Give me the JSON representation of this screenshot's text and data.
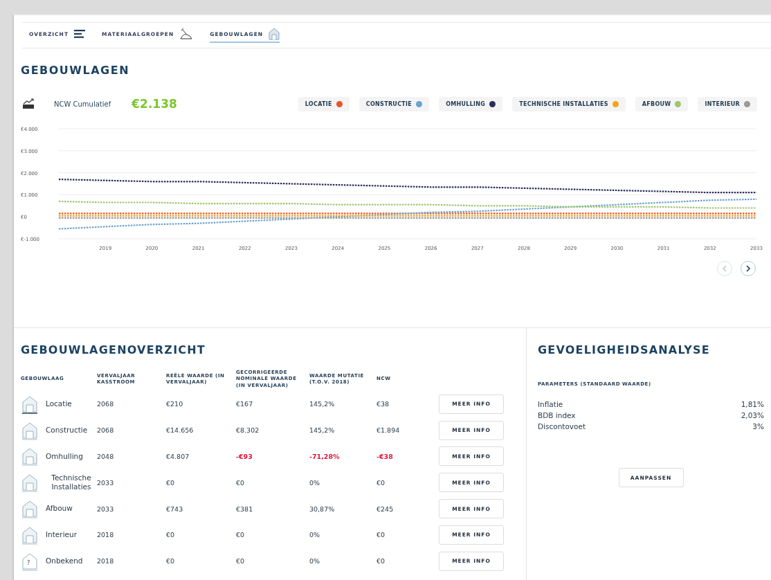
{
  "nav": [
    {
      "label": "OVERZICHT",
      "selected": false
    },
    {
      "label": "MATERIAALGROEPEN",
      "selected": false
    },
    {
      "label": "GEBOUWLAGEN",
      "selected": true
    }
  ],
  "title": "GEBOUWLAGEN",
  "summary": {
    "label": "NCW Cumulatief",
    "value": "€2.138"
  },
  "chart_data": {
    "type": "line",
    "grid": true,
    "xlim": [
      2018,
      2033
    ],
    "x": [
      2018,
      2019,
      2020,
      2021,
      2022,
      2023,
      2024,
      2025,
      2026,
      2027,
      2028,
      2029,
      2030,
      2031,
      2032,
      2033
    ],
    "xticks": [
      2019,
      2020,
      2021,
      2022,
      2023,
      2024,
      2025,
      2026,
      2027,
      2028,
      2029,
      2030,
      2031,
      2032,
      2033
    ],
    "yticks": [
      {
        "value": -1000,
        "label": "€-1.000"
      },
      {
        "value": 0,
        "label": "€0"
      },
      {
        "value": 1000,
        "label": "€1.000"
      },
      {
        "value": 2000,
        "label": "€2.000"
      },
      {
        "value": 3000,
        "label": "€3.000"
      },
      {
        "value": 4000,
        "label": "€4.000"
      }
    ],
    "ylim": [
      -1000,
      4000
    ],
    "series": [
      {
        "name": "LOCATIE",
        "color": "#e9542d",
        "line_style": "dotted",
        "values": [
          150,
          150,
          150,
          150,
          150,
          150,
          150,
          150,
          150,
          150,
          150,
          150,
          150,
          150,
          150,
          150
        ]
      },
      {
        "name": "CONSTRUCTIE",
        "color": "#6aa3cf",
        "line_style": "dotted",
        "values": [
          -550,
          -450,
          -350,
          -300,
          -200,
          -100,
          0,
          100,
          200,
          250,
          350,
          450,
          550,
          650,
          750,
          800
        ]
      },
      {
        "name": "OMHULLING",
        "color": "#2b2d5c",
        "line_style": "dotted",
        "values": [
          1700,
          1650,
          1600,
          1600,
          1550,
          1500,
          1450,
          1400,
          1350,
          1350,
          1300,
          1250,
          1200,
          1150,
          1100,
          1100
        ]
      },
      {
        "name": "TECHNISCHE INSTALLATIES",
        "color": "#f5a31a",
        "line_style": "dotted",
        "values": [
          50,
          50,
          50,
          50,
          50,
          50,
          50,
          50,
          50,
          50,
          50,
          50,
          50,
          50,
          50,
          50
        ]
      },
      {
        "name": "AFBOUW",
        "color": "#9dc66f",
        "line_style": "dotted",
        "values": [
          700,
          650,
          650,
          600,
          600,
          600,
          550,
          550,
          550,
          500,
          500,
          450,
          450,
          450,
          400,
          400
        ]
      },
      {
        "name": "INTERIEUR",
        "color": "#9a9a9a",
        "line_style": "dotted",
        "values": [
          -50,
          -50,
          -50,
          -50,
          -50,
          -50,
          -50,
          -50,
          -50,
          -50,
          -50,
          -50,
          -50,
          -50,
          -50,
          -50
        ]
      }
    ]
  },
  "pager": [
    {
      "disabled": true
    },
    {
      "disabled": false
    }
  ],
  "overview": {
    "title": "GEBOUWLAGENOVERZICHT",
    "columns": [
      "GEBOUWLAAG",
      "VERVALJAAR KASSTROOM",
      "REËLE WAARDE (IN VERVALJAAR)",
      "GECORRIGEERDE NOMINALE WAARDE (IN VERVALJAAR)",
      "WAARDE MUTATIE (T.O.V. 2018)",
      "NCW"
    ],
    "rows": [
      {
        "name": "Locatie",
        "year": "2068",
        "real": "€210",
        "nominal": "€167",
        "mutation": "145,2%",
        "ncw": "€38",
        "negative": false,
        "button": "MEER INFO"
      },
      {
        "name": "Constructie",
        "year": "2068",
        "real": "€14.656",
        "nominal": "€8.302",
        "mutation": "145,2%",
        "ncw": "€1.894",
        "negative": false,
        "button": "MEER INFO"
      },
      {
        "name": "Omhulling",
        "year": "2048",
        "real": "€4.807",
        "nominal": "-€93",
        "mutation": "-71,28%",
        "ncw": "-€38",
        "negative": true,
        "button": "MEER INFO"
      },
      {
        "name": "Technische Installaties",
        "year": "2033",
        "real": "€0",
        "nominal": "€0",
        "mutation": "0%",
        "ncw": "€0",
        "negative": false,
        "button": "MEER INFO"
      },
      {
        "name": "Afbouw",
        "year": "2033",
        "real": "€743",
        "nominal": "€381",
        "mutation": "30,87%",
        "ncw": "€245",
        "negative": false,
        "button": "MEER INFO"
      },
      {
        "name": "Interieur",
        "year": "2018",
        "real": "€0",
        "nominal": "€0",
        "mutation": "0%",
        "ncw": "€0",
        "negative": false,
        "button": "MEER INFO"
      },
      {
        "name": "Onbekend",
        "icon_text": "?",
        "year": "2018",
        "real": "€0",
        "nominal": "€0",
        "mutation": "0%",
        "ncw": "€0",
        "negative": false,
        "button": "MEER INFO"
      }
    ]
  },
  "sensitivity": {
    "title": "GEVOELIGHEIDSANALYSE",
    "subtitle": "PARAMETERS (STANDAARD WAARDE)",
    "params": [
      {
        "label": "Inflatie",
        "value": "1,81%"
      },
      {
        "label": "BDB index",
        "value": "2,03%"
      },
      {
        "label": "Discontovoet",
        "value": "3%"
      }
    ],
    "button": "AANPASSEN"
  }
}
